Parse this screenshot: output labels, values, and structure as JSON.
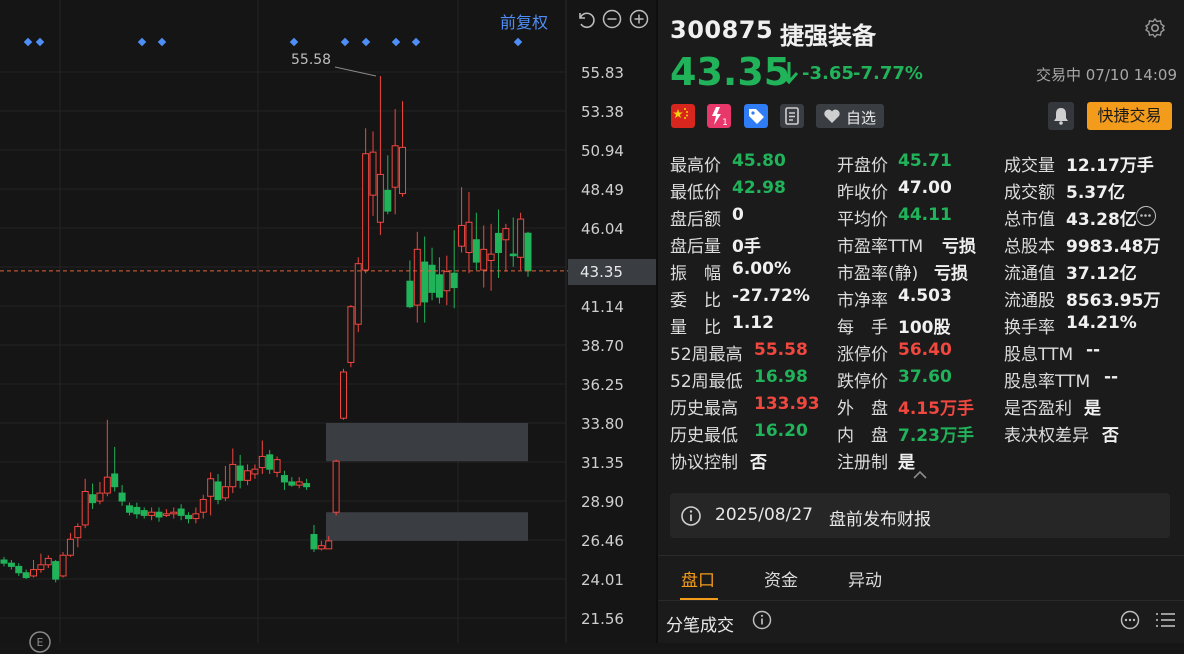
{
  "chart": {
    "adjust_label": "前复权",
    "peak_label": "55.58",
    "price_axis": [
      "55.83",
      "53.38",
      "50.94",
      "48.49",
      "46.04",
      "43.35",
      "41.14",
      "38.70",
      "36.25",
      "33.80",
      "31.35",
      "28.90",
      "26.46",
      "24.01",
      "21.56"
    ],
    "current_price_tag": "43.35",
    "up_color": "#f0473f",
    "down_color": "#21b35a"
  },
  "chart_data": {
    "type": "candlestick",
    "ylim": [
      21.56,
      55.83
    ],
    "candles": [
      {
        "o": 25.2,
        "c": 25.0,
        "h": 25.4,
        "l": 24.8
      },
      {
        "o": 25.0,
        "c": 24.8,
        "h": 25.2,
        "l": 24.6
      },
      {
        "o": 24.8,
        "c": 24.4,
        "h": 25.0,
        "l": 24.2
      },
      {
        "o": 24.4,
        "c": 24.1,
        "h": 24.6,
        "l": 24.0
      },
      {
        "o": 24.2,
        "c": 24.6,
        "h": 25.2,
        "l": 24.1
      },
      {
        "o": 24.6,
        "c": 24.9,
        "h": 25.6,
        "l": 24.4
      },
      {
        "o": 24.9,
        "c": 25.3,
        "h": 25.5,
        "l": 24.7
      },
      {
        "o": 25.1,
        "c": 24.0,
        "h": 25.2,
        "l": 23.8
      },
      {
        "o": 24.2,
        "c": 25.5,
        "h": 25.7,
        "l": 24.1
      },
      {
        "o": 25.5,
        "c": 26.5,
        "h": 26.9,
        "l": 25.4
      },
      {
        "o": 26.6,
        "c": 27.3,
        "h": 27.5,
        "l": 26.0
      },
      {
        "o": 27.4,
        "c": 29.5,
        "h": 30.3,
        "l": 27.2
      },
      {
        "o": 29.3,
        "c": 28.8,
        "h": 30.0,
        "l": 28.4
      },
      {
        "o": 28.9,
        "c": 29.4,
        "h": 30.1,
        "l": 28.7
      },
      {
        "o": 29.4,
        "c": 30.4,
        "h": 34.0,
        "l": 29.2
      },
      {
        "o": 30.6,
        "c": 29.8,
        "h": 32.3,
        "l": 29.5
      },
      {
        "o": 29.4,
        "c": 28.9,
        "h": 29.9,
        "l": 28.6
      },
      {
        "o": 28.6,
        "c": 28.2,
        "h": 28.8,
        "l": 28.0
      },
      {
        "o": 28.5,
        "c": 28.1,
        "h": 28.8,
        "l": 27.8
      },
      {
        "o": 28.3,
        "c": 28.0,
        "h": 28.5,
        "l": 27.8
      },
      {
        "o": 28.0,
        "c": 28.2,
        "h": 28.5,
        "l": 27.7
      },
      {
        "o": 28.2,
        "c": 27.9,
        "h": 28.5,
        "l": 27.6
      },
      {
        "o": 28.0,
        "c": 28.1,
        "h": 28.4,
        "l": 27.9
      },
      {
        "o": 28.1,
        "c": 28.2,
        "h": 28.5,
        "l": 27.8
      },
      {
        "o": 28.4,
        "c": 28.0,
        "h": 28.7,
        "l": 27.7
      },
      {
        "o": 28.0,
        "c": 27.8,
        "h": 28.2,
        "l": 27.5
      },
      {
        "o": 27.8,
        "c": 28.1,
        "h": 28.5,
        "l": 27.5
      },
      {
        "o": 28.2,
        "c": 29.0,
        "h": 29.3,
        "l": 27.8
      },
      {
        "o": 29.2,
        "c": 30.3,
        "h": 30.7,
        "l": 28.0
      },
      {
        "o": 30.1,
        "c": 29.0,
        "h": 30.6,
        "l": 28.7
      },
      {
        "o": 29.1,
        "c": 29.8,
        "h": 31.1,
        "l": 28.9
      },
      {
        "o": 29.8,
        "c": 31.2,
        "h": 32.2,
        "l": 29.4
      },
      {
        "o": 31.1,
        "c": 30.2,
        "h": 31.8,
        "l": 29.7
      },
      {
        "o": 30.2,
        "c": 30.8,
        "h": 31.2,
        "l": 29.9
      },
      {
        "o": 30.6,
        "c": 30.9,
        "h": 31.2,
        "l": 30.3
      },
      {
        "o": 31.0,
        "c": 31.7,
        "h": 32.7,
        "l": 30.6
      },
      {
        "o": 31.8,
        "c": 30.9,
        "h": 32.1,
        "l": 30.6
      },
      {
        "o": 30.7,
        "c": 31.5,
        "h": 31.7,
        "l": 30.4
      },
      {
        "o": 30.5,
        "c": 30.1,
        "h": 30.8,
        "l": 29.6
      },
      {
        "o": 30.1,
        "c": 29.9,
        "h": 30.4,
        "l": 29.8
      },
      {
        "o": 29.9,
        "c": 30.1,
        "h": 30.4,
        "l": 29.7
      },
      {
        "o": 30.0,
        "c": 29.8,
        "h": 30.3,
        "l": 29.6
      },
      {
        "o": 26.8,
        "c": 25.9,
        "h": 27.4,
        "l": 25.7
      },
      {
        "o": 25.9,
        "c": 26.1,
        "h": 26.4,
        "l": 25.8
      },
      {
        "o": 25.9,
        "c": 26.4,
        "h": 26.7,
        "l": 25.9
      },
      {
        "o": 28.2,
        "c": 31.4,
        "h": 31.5,
        "l": 28.0
      },
      {
        "o": 34.1,
        "c": 37.0,
        "h": 37.2,
        "l": 34.0
      },
      {
        "o": 37.6,
        "c": 41.1,
        "h": 41.2,
        "l": 37.3
      },
      {
        "o": 40.0,
        "c": 43.8,
        "h": 44.2,
        "l": 39.5
      },
      {
        "o": 43.4,
        "c": 50.7,
        "h": 52.3,
        "l": 43.2
      },
      {
        "o": 48.1,
        "c": 50.8,
        "h": 52.1,
        "l": 46.8
      },
      {
        "o": 46.4,
        "c": 49.4,
        "h": 55.58,
        "l": 45.6
      },
      {
        "o": 48.4,
        "c": 47.1,
        "h": 50.6,
        "l": 46.9
      },
      {
        "o": 48.6,
        "c": 51.2,
        "h": 53.5,
        "l": 46.9
      },
      {
        "o": 48.2,
        "c": 51.1,
        "h": 54.0,
        "l": 48.0
      },
      {
        "o": 42.7,
        "c": 41.1,
        "h": 44.0,
        "l": 41.0
      },
      {
        "o": 41.2,
        "c": 44.7,
        "h": 45.8,
        "l": 40.1
      },
      {
        "o": 43.9,
        "c": 41.4,
        "h": 45.5,
        "l": 40.1
      },
      {
        "o": 43.7,
        "c": 42.0,
        "h": 44.8,
        "l": 41.5
      },
      {
        "o": 43.1,
        "c": 41.7,
        "h": 44.2,
        "l": 41.3
      },
      {
        "o": 42.1,
        "c": 43.3,
        "h": 44.3,
        "l": 41.2
      },
      {
        "o": 43.2,
        "c": 42.3,
        "h": 45.9,
        "l": 41.0
      },
      {
        "o": 44.9,
        "c": 46.2,
        "h": 48.6,
        "l": 44.5
      },
      {
        "o": 44.5,
        "c": 46.4,
        "h": 48.3,
        "l": 43.2
      },
      {
        "o": 45.3,
        "c": 43.9,
        "h": 47.0,
        "l": 43.4
      },
      {
        "o": 43.4,
        "c": 44.7,
        "h": 46.2,
        "l": 42.3
      },
      {
        "o": 44.0,
        "c": 44.4,
        "h": 46.3,
        "l": 42.1
      },
      {
        "o": 45.7,
        "c": 44.5,
        "h": 47.2,
        "l": 42.9
      },
      {
        "o": 45.3,
        "c": 46.0,
        "h": 46.3,
        "l": 43.3
      },
      {
        "o": 44.4,
        "c": 44.3,
        "h": 46.7,
        "l": 43.6
      },
      {
        "o": 44.2,
        "c": 46.6,
        "h": 47.0,
        "l": 43.4
      },
      {
        "o": 45.71,
        "c": 43.35,
        "h": 45.8,
        "l": 42.98
      }
    ],
    "gaps": [
      [
        28.2,
        26.4
      ],
      [
        33.8,
        31.4
      ]
    ]
  },
  "stock": {
    "code": "300875",
    "name": "捷强装备",
    "price": "43.35",
    "change": "-3.65",
    "change_pct": "-7.77%",
    "status": "交易中 07/10 14:09",
    "fav_label": "自选",
    "quick_trade_label": "快捷交易"
  },
  "stats": {
    "col1": [
      {
        "label": "最高价",
        "value": "45.80",
        "color": "green"
      },
      {
        "label": "最低价",
        "value": "42.98",
        "color": "green"
      },
      {
        "label": "盘后额",
        "value": "0",
        "color": "white"
      },
      {
        "label": "盘后量",
        "value": "0手",
        "color": "white"
      },
      {
        "label": "振　幅",
        "value": "6.00%",
        "color": "white"
      },
      {
        "label": "委　比",
        "value": "-27.72%",
        "color": "white"
      },
      {
        "label": "量　比",
        "value": "1.12",
        "color": "white"
      },
      {
        "label": "52周最高",
        "value": "55.58",
        "color": "red"
      },
      {
        "label": "52周最低",
        "value": "16.98",
        "color": "green"
      },
      {
        "label": "历史最高",
        "value": "133.93",
        "color": "red"
      },
      {
        "label": "历史最低",
        "value": "16.20",
        "color": "green"
      },
      {
        "label": "协议控制",
        "value": "否",
        "color": "white"
      }
    ],
    "col2": [
      {
        "label": "开盘价",
        "value": "45.71",
        "color": "green"
      },
      {
        "label": "昨收价",
        "value": "47.00",
        "color": "white"
      },
      {
        "label": "平均价",
        "value": "44.11",
        "color": "green"
      },
      {
        "label": "市盈率TTM",
        "value": "亏损",
        "color": "white"
      },
      {
        "label": "市盈率(静)",
        "value": "亏损",
        "color": "white"
      },
      {
        "label": "市净率",
        "value": "4.503",
        "color": "white"
      },
      {
        "label": "每　手",
        "value": "100股",
        "color": "white"
      },
      {
        "label": "涨停价",
        "value": "56.40",
        "color": "red"
      },
      {
        "label": "跌停价",
        "value": "37.60",
        "color": "green"
      },
      {
        "label": "外　盘",
        "value": "4.15万手",
        "color": "red"
      },
      {
        "label": "内　盘",
        "value": "7.23万手",
        "color": "green"
      },
      {
        "label": "注册制",
        "value": "是",
        "color": "white"
      }
    ],
    "col3": [
      {
        "label": "成交量",
        "value": "12.17万手",
        "color": "white"
      },
      {
        "label": "成交额",
        "value": "5.37亿",
        "color": "white"
      },
      {
        "label": "总市值",
        "value": "43.28亿",
        "color": "white"
      },
      {
        "label": "总股本",
        "value": "9983.48万",
        "color": "white"
      },
      {
        "label": "流通值",
        "value": "37.12亿",
        "color": "white"
      },
      {
        "label": "流通股",
        "value": "8563.95万",
        "color": "white"
      },
      {
        "label": "换手率",
        "value": "14.21%",
        "color": "white"
      },
      {
        "label": "股息TTM",
        "value": "--",
        "color": "white"
      },
      {
        "label": "股息率TTM",
        "value": "--",
        "color": "white"
      },
      {
        "label": "是否盈利",
        "value": "是",
        "color": "white"
      },
      {
        "label": "表决权差异",
        "value": "否",
        "color": "white"
      }
    ]
  },
  "notice": {
    "date": "2025/08/27",
    "text": "盘前发布财报"
  },
  "tabs": [
    "盘口",
    "资金",
    "异动"
  ],
  "section": {
    "title": "分笔成交"
  },
  "icons": {
    "badges": [
      "china-flag-icon",
      "tag-1-icon",
      "price-tag-icon",
      "document-icon",
      "heart-icon"
    ],
    "controls": [
      "reset-icon",
      "zoom-out-icon",
      "zoom-in-icon"
    ]
  }
}
